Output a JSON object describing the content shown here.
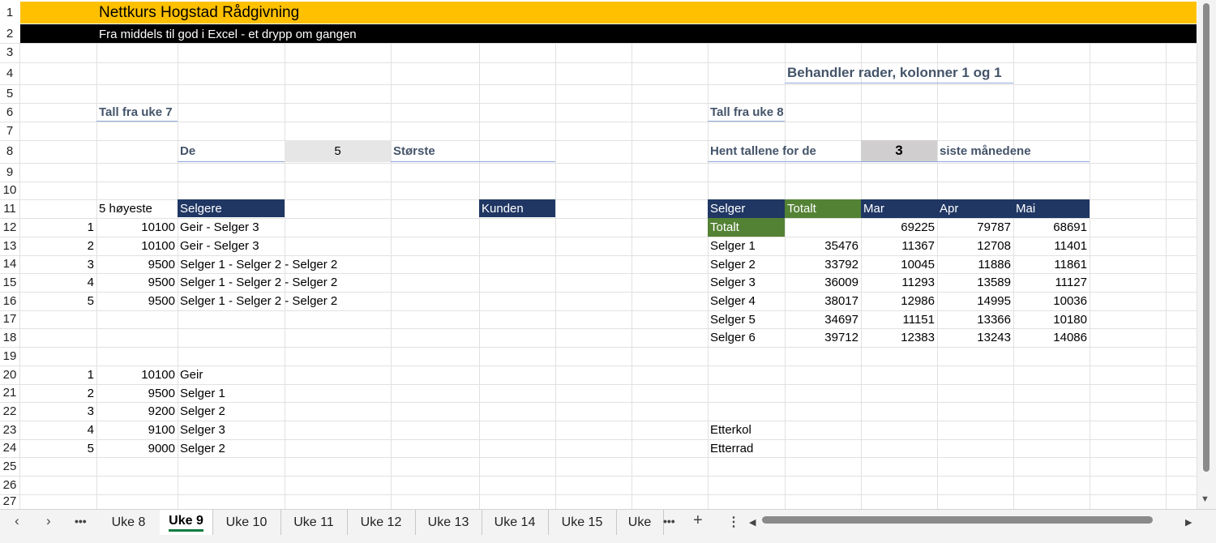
{
  "banner": {
    "title": "Nettkurs Hogstad Rådgivning",
    "subtitle": "Fra middels til god i Excel - et drypp om gangen"
  },
  "row_numbers": [
    "1",
    "2",
    "3",
    "4",
    "5",
    "6",
    "7",
    "8",
    "9",
    "10",
    "11",
    "12",
    "13",
    "14",
    "15",
    "16",
    "17",
    "18",
    "19",
    "20",
    "21",
    "22",
    "23",
    "24",
    "25",
    "26",
    "27"
  ],
  "left": {
    "heading": "Tall fra uke 7",
    "de_label": "De",
    "n_value": "5",
    "storste_label": "Største",
    "top_header": "5 høyeste",
    "selgere_header": "Selgere",
    "kunden_header": "Kunden",
    "top_rows": [
      {
        "rank": "1",
        "value": "10100",
        "names": "Geir - Selger 3"
      },
      {
        "rank": "2",
        "value": "10100",
        "names": "Geir - Selger 3"
      },
      {
        "rank": "3",
        "value": "9500",
        "names": "Selger 1 - Selger 2 - Selger 2"
      },
      {
        "rank": "4",
        "value": "9500",
        "names": "Selger 1 - Selger 2 - Selger 2"
      },
      {
        "rank": "5",
        "value": "9500",
        "names": "Selger 1 - Selger 2 - Selger 2"
      }
    ],
    "bottom_rows": [
      {
        "rank": "1",
        "value": "10100",
        "name": "Geir"
      },
      {
        "rank": "2",
        "value": "9500",
        "name": "Selger 1"
      },
      {
        "rank": "3",
        "value": "9200",
        "name": "Selger 2"
      },
      {
        "rank": "4",
        "value": "9100",
        "name": "Selger 3"
      },
      {
        "rank": "5",
        "value": "9000",
        "name": "Selger 2"
      }
    ]
  },
  "right": {
    "title": "Behandler rader, kolonner 1 og 1",
    "heading": "Tall fra uke 8",
    "hent_label": "Hent tallene for de",
    "n_value": "3",
    "siste_label": "siste månedene",
    "headers": [
      "Selger",
      "Totalt",
      "Mar",
      "Apr",
      "Mai"
    ],
    "totalt_row": {
      "label": "Totalt",
      "total": "",
      "mar": "69225",
      "apr": "79787",
      "mai": "68691"
    },
    "rows": [
      {
        "name": "Selger 1",
        "total": "35476",
        "mar": "11367",
        "apr": "12708",
        "mai": "11401"
      },
      {
        "name": "Selger 2",
        "total": "33792",
        "mar": "10045",
        "apr": "11886",
        "mai": "11861"
      },
      {
        "name": "Selger 3",
        "total": "36009",
        "mar": "11293",
        "apr": "13589",
        "mai": "11127"
      },
      {
        "name": "Selger 4",
        "total": "38017",
        "mar": "12986",
        "apr": "14995",
        "mai": "10036"
      },
      {
        "name": "Selger 5",
        "total": "34697",
        "mar": "11151",
        "apr": "13366",
        "mai": "10180"
      },
      {
        "name": "Selger 6",
        "total": "39712",
        "mar": "12383",
        "apr": "13243",
        "mai": "14086"
      }
    ],
    "etterkol": "Etterkol",
    "etterrad": "Etterrad"
  },
  "tabs": {
    "prev_icon": "chevron-left",
    "next_icon": "chevron-right",
    "more_icon": "ellipsis",
    "add_icon": "plus",
    "menu_icon": "vertical-ellipsis",
    "items": [
      "Uke 8",
      "Uke 9",
      "Uke 10",
      "Uke 11",
      "Uke 12",
      "Uke 13",
      "Uke 14",
      "Uke 15",
      "Uke"
    ],
    "active": "Uke 9"
  },
  "colors": {
    "banner": "#ffc000",
    "navy_header": "#203764",
    "green_header": "#548235",
    "heading_text": "#44546a"
  }
}
